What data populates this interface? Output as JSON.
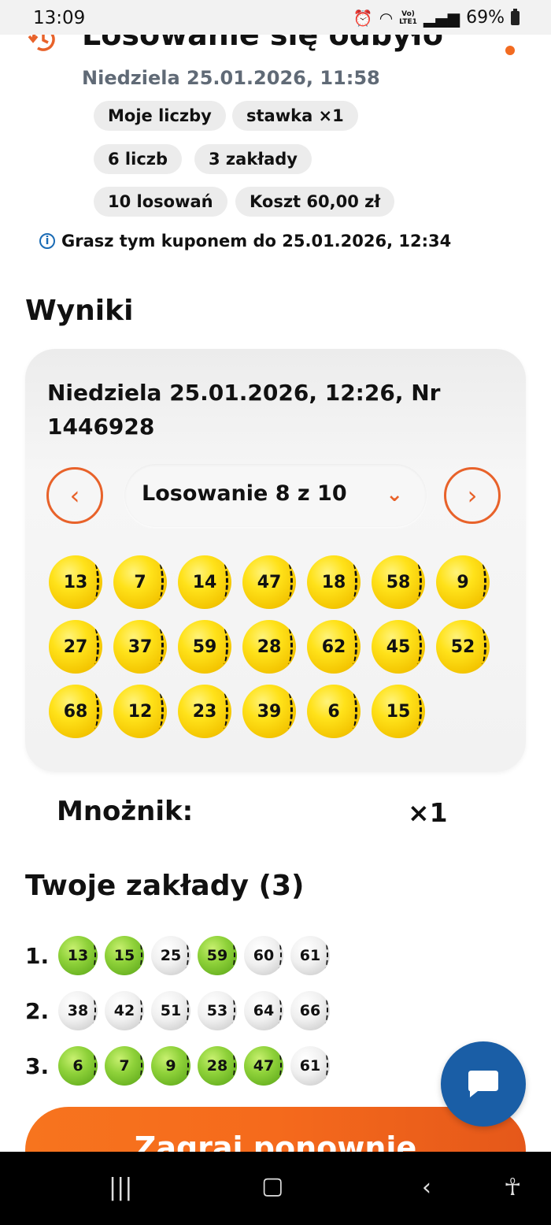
{
  "status_bar": {
    "time": "13:09",
    "battery": "69%",
    "network": "VoLTE1"
  },
  "header": {
    "title": "Losowanie się odbyło",
    "subtitle": "Niedziela 25.01.2026, 11:58",
    "chips": [
      "Moje liczby",
      "stawka ×1",
      "6 liczb",
      "3 zakłady",
      "10 losowań",
      "Koszt 60,00 zł"
    ],
    "info": "Grasz tym kuponem do 25.01.2026, 12:34"
  },
  "results": {
    "heading": "Wyniki",
    "draw_date": "Niedziela 25.01.2026, 12:26, Nr 1446928",
    "draw_selector": "Losowanie 8 z 10",
    "numbers": [
      "13",
      "7",
      "14",
      "47",
      "18",
      "58",
      "9",
      "27",
      "37",
      "59",
      "28",
      "62",
      "45",
      "52",
      "68",
      "12",
      "23",
      "39",
      "6",
      "15"
    ]
  },
  "multiplier": {
    "label": "Mnożnik:",
    "value": "×1"
  },
  "bets": {
    "heading": "Twoje zakłady (3)",
    "rows": [
      {
        "label": "1.",
        "balls": [
          {
            "n": "13",
            "hit": true
          },
          {
            "n": "15",
            "hit": true
          },
          {
            "n": "25",
            "hit": false
          },
          {
            "n": "59",
            "hit": true
          },
          {
            "n": "60",
            "hit": false
          },
          {
            "n": "61",
            "hit": false
          }
        ]
      },
      {
        "label": "2.",
        "balls": [
          {
            "n": "38",
            "hit": false
          },
          {
            "n": "42",
            "hit": false
          },
          {
            "n": "51",
            "hit": false
          },
          {
            "n": "53",
            "hit": false
          },
          {
            "n": "64",
            "hit": false
          },
          {
            "n": "66",
            "hit": false
          }
        ]
      },
      {
        "label": "3.",
        "balls": [
          {
            "n": "6",
            "hit": true
          },
          {
            "n": "7",
            "hit": true
          },
          {
            "n": "9",
            "hit": true
          },
          {
            "n": "28",
            "hit": true
          },
          {
            "n": "47",
            "hit": true
          },
          {
            "n": "61",
            "hit": false
          }
        ]
      }
    ]
  },
  "cta": {
    "label": "Zagraj ponownie"
  },
  "icons": {
    "history": "history-icon",
    "info": "info-icon",
    "prev": "chevron-left-icon",
    "next": "chevron-right-icon",
    "dropdown": "chevron-down-icon",
    "chat": "chat-icon"
  },
  "colors": {
    "accent": "#e8622a",
    "hit_ball": "#8fd23a",
    "draw_ball": "#ffe21a",
    "chat_fab": "#1a5ea6"
  }
}
